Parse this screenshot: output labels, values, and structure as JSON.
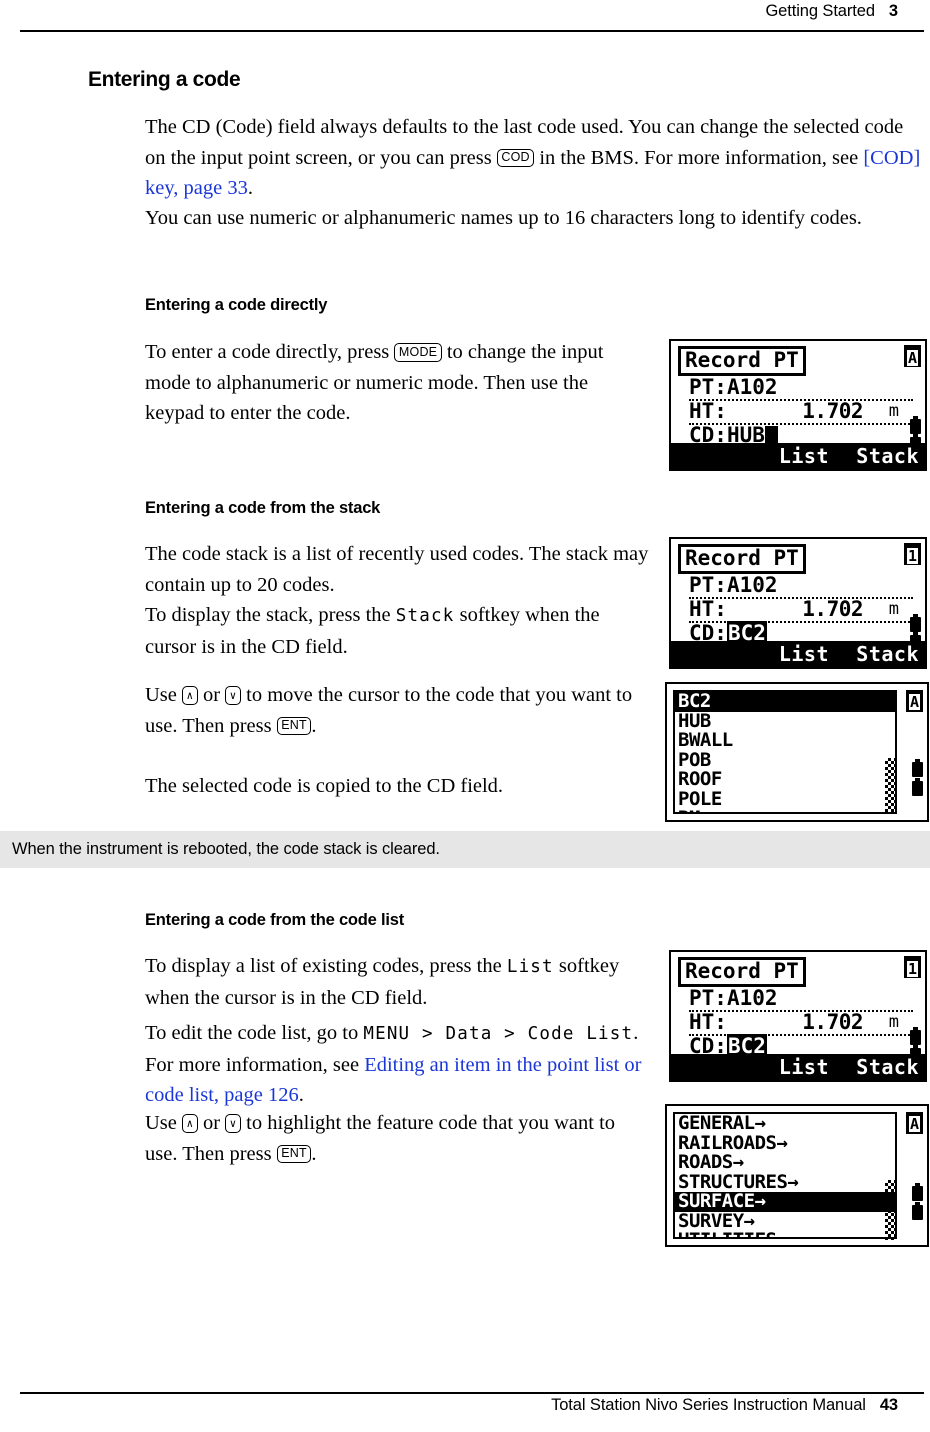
{
  "header": {
    "chapter_title": "Getting Started",
    "chapter_number": "3"
  },
  "footer": {
    "manual_title": "Total Station Nivo Series Instruction Manual",
    "page_number": "43"
  },
  "sections": {
    "h1_entering_a_code": "Entering a code",
    "p_intro_1a": "The CD (Code) field always defaults to the last code used. You can change the selected code on the input point screen, or you can press ",
    "key_cod": "COD",
    "p_intro_1b": " in the BMS. For more information, see ",
    "link_cod_key": "[COD] key, page 33",
    "p_intro_1c": ".",
    "p_intro_2": "You can use numeric or alphanumeric names up to 16 characters long to identify codes.",
    "h2_directly": "Entering a code directly",
    "p_directly_a": "To enter a code directly, press ",
    "key_mode": "MODE",
    "p_directly_b": " to change the input mode to alphanumeric or numeric mode. Then use the keypad to enter the code.",
    "h2_stack": "Entering a code from the stack",
    "p_stack_1": "The code stack is a list of recently used codes. The stack may contain up to 20 codes.",
    "p_stack_2a": "To display the stack, press the ",
    "softkey_stack": "Stack",
    "p_stack_2b": " softkey when the cursor is in the CD field.",
    "p_stack_3a": "Use ",
    "key_up": "∧",
    "p_stack_3b": " or ",
    "key_down": "∨",
    "p_stack_3c": " to move the cursor to the code that you want to use. Then press ",
    "key_ent": "ENT",
    "p_stack_3d": ".",
    "p_stack_4": "The selected code is copied to the CD field.",
    "note_reboot": "When the instrument is rebooted, the code stack is cleared.",
    "h2_codelist": "Entering a code from the code list",
    "p_codelist_1a": "To display a list of existing codes, press the ",
    "softkey_list": "List",
    "p_codelist_1b": " softkey when the cursor is in the CD field.",
    "p_codelist_2a": "To edit the code list, go to ",
    "menupath": "MENU > Data > Code List",
    "p_codelist_2b": ". For more information, see ",
    "link_editing_item": "Editing an item in the point list or code list, page 126",
    "p_codelist_2c": ".",
    "p_codelist_3a": "Use ",
    "p_codelist_3b": " or ",
    "p_codelist_3c": " to highlight the feature code that you want to use. Then press ",
    "p_codelist_3d": "."
  },
  "screens": {
    "record_pt_hub": {
      "title": "Record PT",
      "mode_indicator": "A",
      "pt_label": "PT:",
      "pt_value": "A102",
      "ht_label": "HT:",
      "ht_value": "1.702",
      "ht_unit": "m",
      "cd_label": "CD:",
      "cd_value": "HUB",
      "cd_highlighted": false,
      "cd_cursor": true,
      "softkey_left": "List",
      "softkey_right": "Stack"
    },
    "record_pt_bc2_stack": {
      "title": "Record PT",
      "mode_indicator": "1",
      "pt_label": "PT:",
      "pt_value": "A102",
      "ht_label": "HT:",
      "ht_value": "1.702",
      "ht_unit": "m",
      "cd_label": "CD:",
      "cd_value": "BC2",
      "cd_highlighted": true,
      "cd_cursor": false,
      "softkey_left": "List",
      "softkey_right": "Stack"
    },
    "record_pt_bc2_list": {
      "title": "Record PT",
      "mode_indicator": "1",
      "pt_label": "PT:",
      "pt_value": "A102",
      "ht_label": "HT:",
      "ht_value": "1.702",
      "ht_unit": "m",
      "cd_label": "CD:",
      "cd_value": "BC2",
      "cd_highlighted": true,
      "cd_cursor": false,
      "softkey_left": "List",
      "softkey_right": "Stack"
    },
    "code_stack_list": {
      "mode_indicator": "A",
      "selected_index": 0,
      "items": [
        "BC2",
        "HUB",
        "BWALL",
        "POB",
        "ROOF",
        "POLE",
        "BM"
      ]
    },
    "feature_code_list": {
      "mode_indicator": "A",
      "selected_index": 4,
      "items": [
        "GENERAL→",
        "RAILROADS→",
        "ROADS→",
        "STRUCTURES→",
        "SURFACE→",
        "SURVEY→",
        "UTILITIES→"
      ]
    }
  },
  "colors": {
    "link": "#1a36d8",
    "note_bg": "#e6e6e6",
    "text": "#000000"
  }
}
